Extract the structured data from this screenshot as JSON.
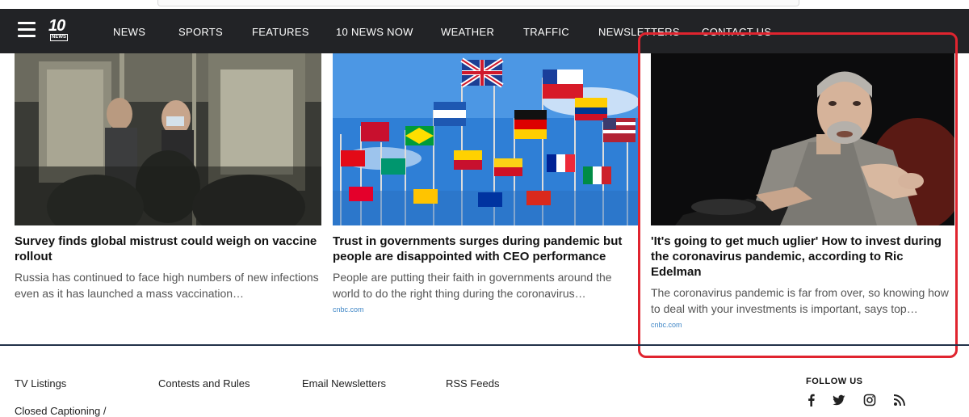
{
  "nav": {
    "logo_text": "10",
    "logo_tag": "NEWS",
    "items": [
      "NEWS",
      "SPORTS",
      "FEATURES",
      "10 NEWS NOW",
      "WEATHER",
      "TRAFFIC",
      "NEWSLETTERS",
      "CONTACT US"
    ]
  },
  "cards": [
    {
      "title": "Survey finds global mistrust could weigh on vaccine rollout",
      "description": "Russia has continued to face high numbers of new infections even as it has launched a mass vaccination…",
      "source": ""
    },
    {
      "title": "Trust in governments surges during pandemic but people are disappointed with CEO performance",
      "description": "People are putting their faith in governments around the world to do the right thing during the coronavirus…",
      "source": "cnbc.com"
    },
    {
      "title": "'It's going to get much uglier' How to invest during the coronavirus pandemic, according to Ric Edelman",
      "description": "The coronavirus pandemic is far from over, so knowing how to deal with your investments is important, says top…",
      "source": "cnbc.com"
    }
  ],
  "footer": {
    "links": [
      "TV Listings",
      "Contests and Rules",
      "Email Newsletters",
      "RSS Feeds"
    ],
    "follow_label": "FOLLOW US",
    "cutoff_text": "Closed Captioning /",
    "social": [
      "facebook-icon",
      "twitter-icon",
      "instagram-icon",
      "rss-icon"
    ]
  },
  "colors": {
    "nav_bg": "#222326",
    "highlight": "#e0242f",
    "source_link": "#3f86c6",
    "footer_rule": "#22324a"
  }
}
